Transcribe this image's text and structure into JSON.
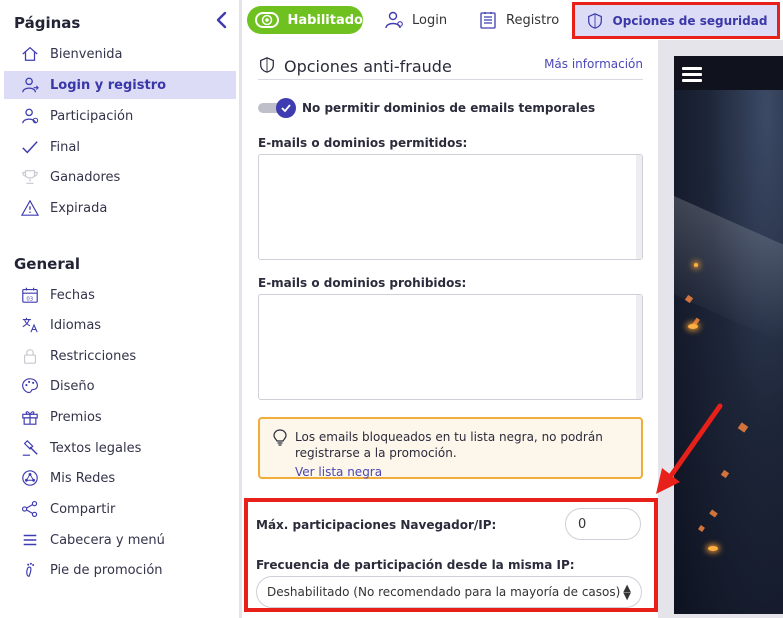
{
  "sidebar": {
    "pages_title": "Páginas",
    "general_title": "General",
    "pages": [
      {
        "label": "Bienvenida",
        "icon": "home-icon"
      },
      {
        "label": "Login y registro",
        "icon": "user-login-icon",
        "active": true
      },
      {
        "label": "Participación",
        "icon": "user-participation-icon"
      },
      {
        "label": "Final",
        "icon": "check-icon"
      },
      {
        "label": "Ganadores",
        "icon": "trophy-icon"
      },
      {
        "label": "Expirada",
        "icon": "warning-icon"
      }
    ],
    "general": [
      {
        "label": "Fechas",
        "icon": "calendar-icon"
      },
      {
        "label": "Idiomas",
        "icon": "translate-icon"
      },
      {
        "label": "Restricciones",
        "icon": "lock-icon"
      },
      {
        "label": "Diseño",
        "icon": "palette-icon"
      },
      {
        "label": "Premios",
        "icon": "gift-icon"
      },
      {
        "label": "Textos legales",
        "icon": "gavel-icon"
      },
      {
        "label": "Mis Redes",
        "icon": "network-icon"
      },
      {
        "label": "Compartir",
        "icon": "share-icon"
      },
      {
        "label": "Cabecera y menú",
        "icon": "menu-icon"
      },
      {
        "label": "Pie de promoción",
        "icon": "footer-icon"
      }
    ]
  },
  "topbar": {
    "enabled_label": "Habilitado",
    "login_label": "Login",
    "registro_label": "Registro",
    "security_label": "Opciones de seguridad"
  },
  "antifraud": {
    "title": "Opciones anti-fraude",
    "more_info": "Más información",
    "temp_email_toggle_label": "No permitir dominios de emails temporales",
    "temp_email_toggle_on": true,
    "allowed_label": "E-mails o dominios permitidos:",
    "allowed_value": "",
    "blocked_label": "E-mails o dominios prohibidos:",
    "blocked_value": "",
    "notice_text": "Los emails bloqueados en tu lista negra, no podrán registrarse a la promoción.",
    "notice_link": "Ver lista negra",
    "max_ip_label": "Máx. participaciones Navegador/IP:",
    "max_ip_value": "0",
    "freq_label": "Frecuencia de participación desde la misma IP:",
    "freq_value": "Deshabilitado (No recomendado para la mayoría de casos)"
  },
  "colors": {
    "accent": "#3e3cb0",
    "active_bg": "#dcdcf6",
    "enabled_green": "#6fc11f",
    "highlight_red": "#e8201a",
    "notice_border": "#f0ad3a"
  }
}
